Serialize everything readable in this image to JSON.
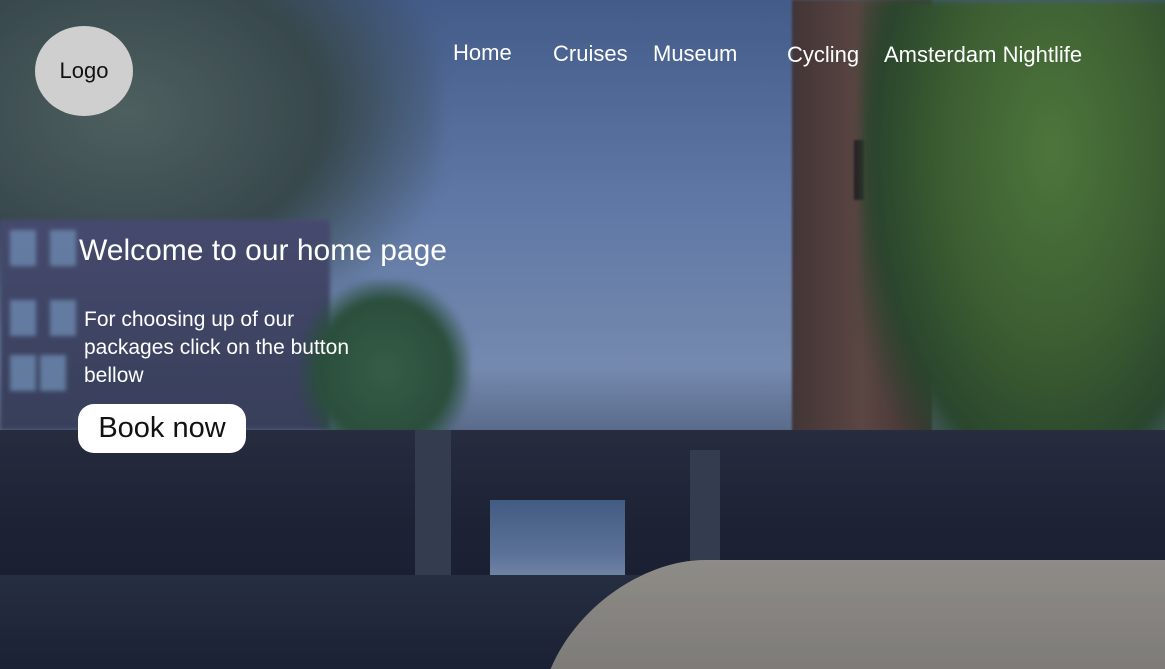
{
  "logo": {
    "label": "Logo"
  },
  "nav": {
    "items": [
      {
        "label": "Home"
      },
      {
        "label": "Cruises"
      },
      {
        "label": "Museum"
      },
      {
        "label": "Cycling"
      },
      {
        "label": "Amsterdam Nightlife"
      }
    ]
  },
  "hero": {
    "headline": "Welcome to our home page",
    "tagline": "For choosing up of our packages click on the button bellow",
    "cta_label": "Book now"
  },
  "colors": {
    "overlay": "#1e3c78",
    "button_bg": "#ffffff",
    "text": "#ffffff"
  }
}
